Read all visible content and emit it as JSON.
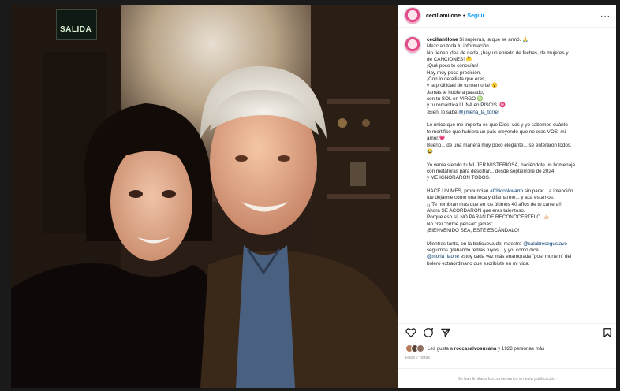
{
  "post": {
    "username": "ceciliamilone",
    "separator": "•",
    "follow": "Seguir",
    "more": "···",
    "photo_sign": "SALIDA"
  },
  "caption": [
    {
      "type": "first",
      "user": "ceciliamilone",
      "text": " Si supieras, la que se armó. 🙏"
    },
    {
      "text": "Mezclan toda tu información."
    },
    {
      "text": "No tienen idea de nada, ¡hay un enredo de fechas, de mujeres y"
    },
    {
      "text": "de CANCIONES! 🤔"
    },
    {
      "text": "¡Qué poco te conocían!"
    },
    {
      "text": "Hay muy poca precisión."
    },
    {
      "text": "¡Con lo detallista que eras,"
    },
    {
      "text": "y la prolijidad de tu memoria! 😮"
    },
    {
      "text": "Jamás te hubiera pasado,"
    },
    {
      "text": "con tu SOL en VIRGO ♍"
    },
    {
      "text": "y tu romántica LUNA en PISCIS. ♓"
    },
    {
      "type": "mention",
      "pre": "¡Bien, lo sabe ",
      "mention": "@jimena_la_torre",
      "post": "!"
    },
    {
      "type": "gap"
    },
    {
      "text": "Lo único que me importa es que Dios, vos y yo sabemos cuánto"
    },
    {
      "text": "te mortificó que hubiera un país creyendo que no eras VOS, mi"
    },
    {
      "text": "amor.💗"
    },
    {
      "text": "Bueno... de una manera muy poco elegante... se enteraron todos."
    },
    {
      "text": "😂"
    },
    {
      "type": "gap"
    },
    {
      "text": "Yo venía siendo tu MUJER MISTERIOSA, haciéndote un homenaje"
    },
    {
      "text": "con metáforas para descifrar... desde septiembre de 2024"
    },
    {
      "text": "y ME IGNORARON TODOS."
    },
    {
      "type": "gap"
    },
    {
      "type": "mention",
      "pre": "HACE UN MES, pronuncian ",
      "mention": "#ChicoNovarro",
      "post": " sin parar. La intención"
    },
    {
      "text": "fue dejarme como una loca y difamarme... y acá estamos:"
    },
    {
      "text": "¡¡¡Te nombran más que en los últimos 40 años de tu carrera!!!"
    },
    {
      "text": "Ahora SE ACORDARON que eras talentoso."
    },
    {
      "text": "Porque eso sí, NO PARAN DE RECONOCÉRTELO. 👍🏻"
    },
    {
      "text": "No creí \"oírme pensar\" jamás:"
    },
    {
      "text": "¡BIENVENIDO SEA, ESTE ESCÁNDALO!"
    },
    {
      "type": "gap"
    },
    {
      "type": "mention",
      "pre": "Mientras tanto, en la baticueva del maestro ",
      "mention": "@calabresegustavo",
      "post": ""
    },
    {
      "text": "seguimos grabando temas tuyos... y yo, como dice"
    },
    {
      "type": "mention",
      "pre": "",
      "mention": "@moria_laone",
      "post": " estoy cada vez más enamorada \"post mortem\" del"
    },
    {
      "text": "bolero extraordinario que escribiste en mi vida."
    }
  ],
  "icons": {
    "like": "heart-icon",
    "comment": "comment-icon",
    "share": "send-icon",
    "save": "bookmark-icon"
  },
  "likes": {
    "prefix": "Les gusta a ",
    "user": "roccasalvosusana",
    "suffix": " y 1928 personas más"
  },
  "time": "Hace 7 horas",
  "footer": "Se han limitado los comentarios en esta publicación."
}
